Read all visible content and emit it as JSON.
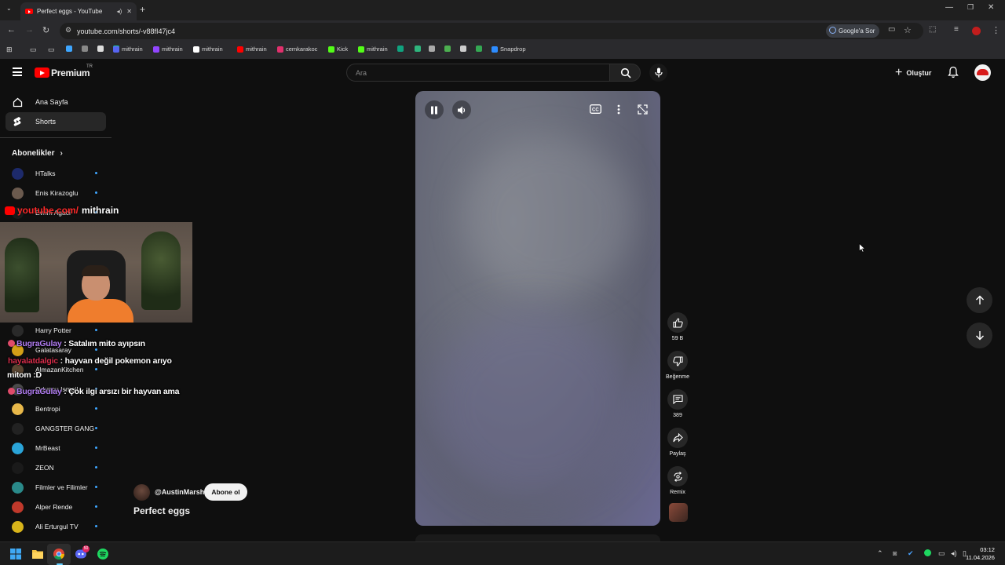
{
  "browser": {
    "tab_title": "Perfect eggs - YouTube",
    "url": "youtube.com/shorts/-v88fI47jc4",
    "google_sor": "Google'a Sor",
    "bookmarks": [
      {
        "label": "",
        "color": "#3ea6ff"
      },
      {
        "label": "",
        "color": "#888"
      },
      {
        "label": "",
        "color": "#ddd"
      },
      {
        "label": "",
        "color": "#1ec6a4"
      },
      {
        "label": "",
        "color": "#7a8cff"
      },
      {
        "label": "mithrain",
        "color": "#5865f2"
      },
      {
        "label": "mithrain",
        "color": "#9146ff"
      },
      {
        "label": "mithrain",
        "color": "#ffffff"
      },
      {
        "label": "mithrain",
        "color": "#ff0000"
      },
      {
        "label": "cemkarakoc",
        "color": "#e1306c"
      },
      {
        "label": "Kick",
        "color": "#53fc18"
      },
      {
        "label": "mithrain",
        "color": "#53fc18"
      },
      {
        "label": "",
        "color": "#10a37f"
      },
      {
        "label": "",
        "color": "#2fb57d"
      },
      {
        "label": "",
        "color": "#aaa"
      },
      {
        "label": "",
        "color": "#4caf50"
      },
      {
        "label": "",
        "color": "#ccc"
      },
      {
        "label": "",
        "color": "#34a853"
      },
      {
        "label": "Snapdrop",
        "color": "#2d8cff"
      }
    ]
  },
  "youtube": {
    "logo_text": "Premium",
    "logo_region": "TR",
    "search_placeholder": "Ara",
    "create_label": "Oluştur"
  },
  "sidebar": {
    "nav": [
      {
        "label": "Ana Sayfa"
      },
      {
        "label": "Shorts"
      }
    ],
    "subscriptions_header": "Abonelikler",
    "subscriptions": [
      {
        "label": "HTalks",
        "color": "#1d2a6b"
      },
      {
        "label": "Enis Kirazoglu",
        "color": "#6b5a4e"
      },
      {
        "label": "Evrim Agaci",
        "color": "#1a1a1a"
      },
      {
        "label": "Harry Potter",
        "color": "#2a2a2a"
      },
      {
        "label": "Galatasaray",
        "color": "#d4a017"
      },
      {
        "label": "AlmazanKitchen",
        "color": "#5a4632"
      },
      {
        "label": "Oduncu Ismail",
        "color": "#4a4a4a"
      },
      {
        "label": "Bentropi",
        "color": "#e8b84a"
      },
      {
        "label": "GANGSTER GANG",
        "color": "#222"
      },
      {
        "label": "MrBeast",
        "color": "#2aa4d8"
      },
      {
        "label": "ZEON",
        "color": "#1a1a1a"
      },
      {
        "label": "Filmler ve Filimler",
        "color": "#2a8a8a"
      },
      {
        "label": "Alper Rende",
        "color": "#c0392b"
      },
      {
        "label": "Ali Erturgul TV",
        "color": "#d8b41a"
      }
    ]
  },
  "stream_overlay": {
    "brand_faint": "youtube.com/",
    "brand": "mithrain",
    "chat": [
      {
        "user": "BugraGulay",
        "message": ": Satalım mito ayıpsın",
        "user_color": "purple"
      },
      {
        "user": "hayalatdalgic",
        "message": ": hayvan değil pokemon arıyo",
        "cont": "mitom :D",
        "user_color": "red"
      },
      {
        "user": "BugraGulay",
        "message": ": Çok ilgi arsızı bir hayvan ama",
        "user_color": "purple"
      }
    ]
  },
  "short": {
    "channel": "@AustinMarsh",
    "subscribe_label": "Abone ol",
    "title": "Perfect eggs",
    "like_count": "59 B",
    "dislike_label": "Beğenme",
    "comment_count": "389",
    "share_label": "Paylaş",
    "remix_label": "Remix"
  },
  "taskbar": {
    "time": "03:12",
    "date": "11.04.2026",
    "discord_badge": "50"
  }
}
